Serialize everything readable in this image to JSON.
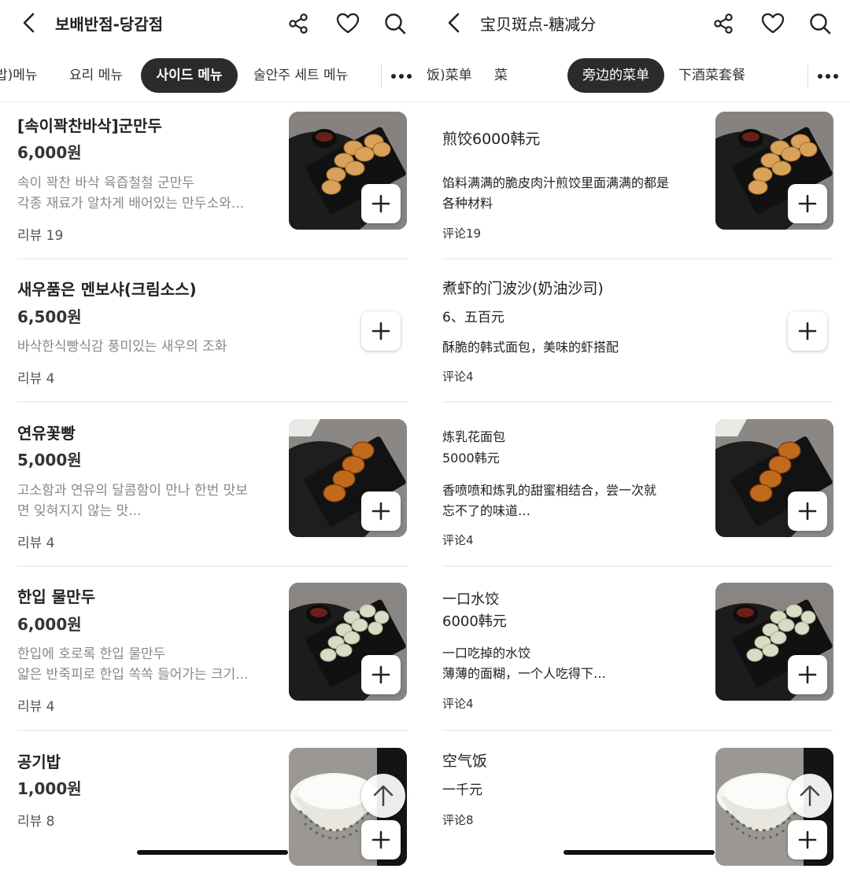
{
  "colors": {
    "active_tab_bg": "#2b2b2b",
    "text": "#222222",
    "muted": "#888888"
  },
  "left": {
    "title": "보배반점-당감점",
    "tabs": [
      {
        "label": "밥)메뉴"
      },
      {
        "label": "요리 메뉴"
      },
      {
        "label": "사이드 메뉴",
        "active": true
      },
      {
        "label": "술안주 세트 메뉴"
      }
    ],
    "items": [
      {
        "name": "[속이꽉찬바삭]군만두",
        "price": "6,000원",
        "desc1": "속이 꽉찬 바삭 육즙철철 군만두",
        "desc2": "각종 재료가 알차게 배어있는 만두소와...",
        "review": "리뷰 19",
        "image": "fried-dumplings"
      },
      {
        "name": "새우품은 멘보샤(크림소스)",
        "price": "6,500원",
        "desc1": "바삭한식빵식감 풍미있는 새우의 조화",
        "desc2": "",
        "review": "리뷰 4",
        "image": ""
      },
      {
        "name": "연유꽃빵",
        "price": "5,000원",
        "desc1": "고소함과 연유의 달콤함이 만나 한번 맛보",
        "desc2": "면 잊혀지지 않는 맛...",
        "review": "리뷰 4",
        "image": "flower-buns"
      },
      {
        "name": "한입 물만두",
        "price": "6,000원",
        "desc1": "한입에 호로록 한입 물만두",
        "desc2": "얇은 반죽피로 한입 쏙쏙 들어가는 크기...",
        "review": "리뷰 4",
        "image": "boiled-dumplings"
      },
      {
        "name": "공기밥",
        "price": "1,000원",
        "desc1": "",
        "desc2": "",
        "review": "리뷰 8",
        "image": "rice-bowl"
      }
    ]
  },
  "right": {
    "title": "宝贝斑点-糖减分",
    "tabs": [
      {
        "label": "饭)菜单"
      },
      {
        "label": "菜"
      },
      {
        "label": "旁边的菜单",
        "active": true
      },
      {
        "label": "下酒菜套餐"
      }
    ],
    "items": [
      {
        "name": "煎饺6000韩元",
        "price": "",
        "desc1": "馅料满满的脆皮肉汁煎饺里面满满的都是",
        "desc2": "各种材料",
        "review": "评论19",
        "image": "fried-dumplings"
      },
      {
        "name": "煮虾的门波沙(奶油沙司)",
        "price": "6、五百元",
        "desc1": "酥脆的韩式面包，美味的虾搭配",
        "desc2": "",
        "review": "评论4",
        "image": ""
      },
      {
        "name": "炼乳花面包",
        "price": "5000韩元",
        "desc1": "香喷喷和炼乳的甜蜜相结合，尝一次就",
        "desc2": "忘不了的味道…",
        "review": "评论4",
        "image": "flower-buns"
      },
      {
        "name": "一口水饺",
        "price": "6000韩元",
        "desc1": "一口吃掉的水饺",
        "desc2": "薄薄的面糊，一个人吃得下…",
        "review": "评论4",
        "image": "boiled-dumplings"
      },
      {
        "name": "空气饭",
        "price": "一千元",
        "desc1": "",
        "desc2": "",
        "review": "评论8",
        "image": "rice-bowl"
      }
    ]
  }
}
